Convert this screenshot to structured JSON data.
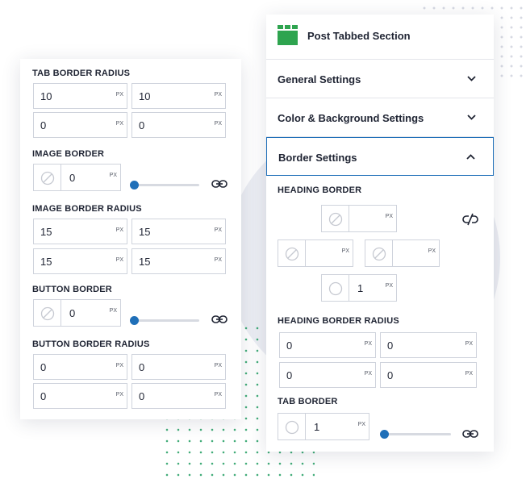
{
  "left_panel": {
    "tab_border_radius": {
      "label": "TAB BORDER RADIUS",
      "values": [
        "10",
        "10",
        "0",
        "0"
      ],
      "unit": "PX"
    },
    "image_border": {
      "label": "IMAGE BORDER",
      "width": "0",
      "unit": "PX",
      "slider_level": 0
    },
    "image_border_radius": {
      "label": "IMAGE BORDER RADIUS",
      "values": [
        "15",
        "15",
        "15",
        "15"
      ],
      "unit": "PX"
    },
    "button_border": {
      "label": "BUTTON BORDER",
      "width": "0",
      "unit": "PX",
      "slider_level": 0
    },
    "button_border_radius": {
      "label": "BUTTON BORDER RADIUS",
      "values": [
        "0",
        "0",
        "0",
        "0"
      ],
      "unit": "PX"
    }
  },
  "right_panel": {
    "title": "Post Tabbed Section",
    "sections": [
      {
        "label": "General Settings",
        "expanded": false
      },
      {
        "label": "Color & Background Settings",
        "expanded": false
      },
      {
        "label": "Border Settings",
        "expanded": true
      }
    ],
    "heading_border": {
      "label": "HEADING BORDER",
      "top": "",
      "left": "",
      "right": "",
      "bottom": "1",
      "unit": "PX"
    },
    "heading_border_radius": {
      "label": "HEADING BORDER RADIUS",
      "values": [
        "0",
        "0",
        "0",
        "0"
      ],
      "unit": "PX"
    },
    "tab_border": {
      "label": "TAB BORDER",
      "width": "1",
      "unit": "PX",
      "slider_level": 0
    }
  },
  "colors": {
    "accent": "#1f6fb8",
    "logo_green": "#2ea44f",
    "border": "#cfd3dc"
  },
  "icons": [
    "post-tabbed-logo-icon",
    "chevron-down-icon",
    "chevron-up-icon",
    "none-style-icon",
    "solid-style-icon",
    "link-icon",
    "unlink-icon"
  ]
}
